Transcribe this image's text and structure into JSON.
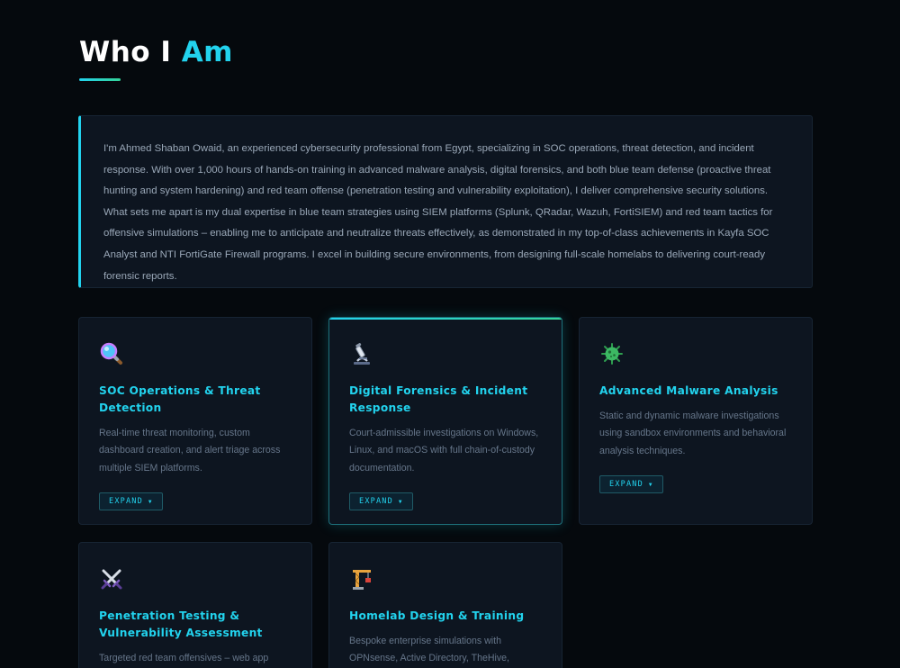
{
  "heading": {
    "prefix": "Who I",
    "accent": "Am"
  },
  "intro": "I'm Ahmed Shaban Owaid, an experienced cybersecurity professional from Egypt, specializing in SOC operations, threat detection, and incident response. With over 1,000 hours of hands-on training in advanced malware analysis, digital forensics, and both blue team defense (proactive threat hunting and system hardening) and red team offense (penetration testing and vulnerability exploitation), I deliver comprehensive security solutions. What sets me apart is my dual expertise in blue team strategies using SIEM platforms (Splunk, QRadar, Wazuh, FortiSIEM) and red team tactics for offensive simulations – enabling me to anticipate and neutralize threats effectively, as demonstrated in my top-of-class achievements in Kayfa SOC Analyst and NTI FortiGate Firewall programs. I excel in building secure environments, from designing full-scale homelabs to delivering court-ready forensic reports.",
  "expand_label": "EXPAND",
  "expand_caret": "▼",
  "cards": [
    {
      "icon": "magnifying-glass-icon",
      "title": "SOC Operations & Threat Detection",
      "desc": "Real-time threat monitoring, custom dashboard creation, and alert triage across multiple SIEM platforms."
    },
    {
      "icon": "microscope-icon",
      "title": "Digital Forensics & Incident Response",
      "desc": "Court-admissible investigations on Windows, Linux, and macOS with full chain-of-custody documentation."
    },
    {
      "icon": "virus-icon",
      "title": "Advanced Malware Analysis",
      "desc": "Static and dynamic malware investigations using sandbox environments and behavioral analysis techniques."
    },
    {
      "icon": "crossed-swords-icon",
      "title": "Penetration Testing & Vulnerability Assessment",
      "desc": "Targeted red team offensives – web app"
    },
    {
      "icon": "construction-crane-icon",
      "title": "Homelab Design & Training",
      "desc": "Bespoke enterprise simulations with OPNsense, Active Directory, TheHive, Cortex,"
    }
  ]
}
